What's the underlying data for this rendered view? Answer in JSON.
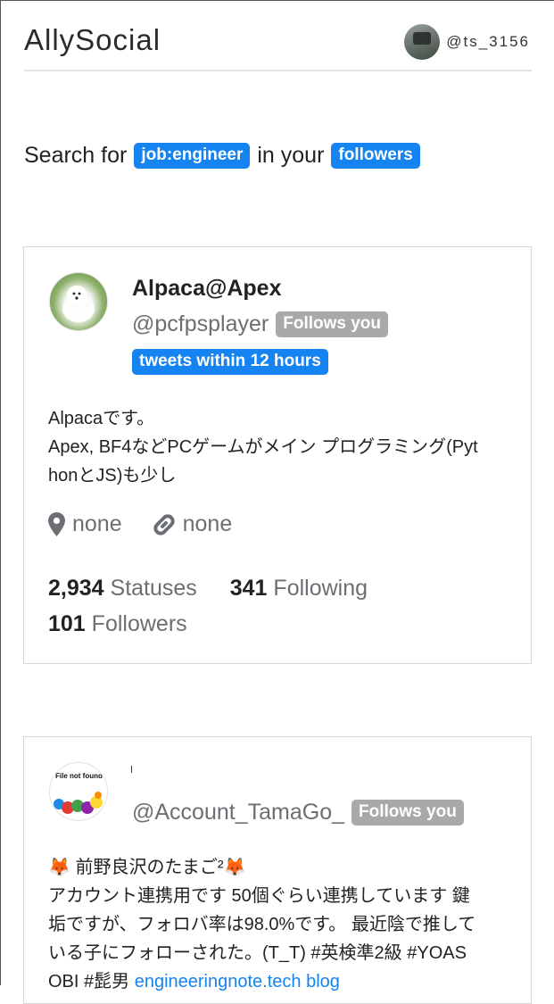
{
  "app": {
    "title": "AllySocial"
  },
  "user": {
    "handle": "@ts_3156"
  },
  "search": {
    "prefix": "Search for",
    "query_tag": "job:engineer",
    "middle": "in your",
    "scope_tag": "followers"
  },
  "results": [
    {
      "name": "Alpaca@Apex",
      "handle": "@pcfpsplayer",
      "follows_badge": "Follows you",
      "activity_badge": "tweets within 12 hours",
      "bio_lines": [
        "Alpacaです。",
        "Apex, BF4などPCゲームがメイン プログラミング(Pyt",
        "honとJS)も少し"
      ],
      "location": "none",
      "url": "none",
      "statuses_count": "2,934",
      "statuses_label": "Statuses",
      "following_count": "341",
      "following_label": "Following",
      "followers_count": "101",
      "followers_label": "Followers"
    },
    {
      "name": "",
      "handle": "@Account_TamaGo_",
      "follows_badge": "Follows you",
      "avatar_text": "File not found",
      "bio_lines": [
        "🦊 前野良沢のたまご²🦊",
        "アカウント連携用です 50個ぐらい連携しています 鍵",
        "垢ですが、フォロバ率は98.0%です。 最近陰で推して",
        "いる子にフォローされた。(T_T) #英検準2級 #YOAS"
      ],
      "bio_last_prefix": "OBI #髭男",
      "bio_link": "engineeringnote.tech blog"
    }
  ],
  "icons": {
    "location": "map-marker-icon",
    "link": "link-icon"
  },
  "colors": {
    "accent": "#1583f0",
    "badge_gray": "#a9a9a9",
    "muted_text": "#6b6f73"
  }
}
